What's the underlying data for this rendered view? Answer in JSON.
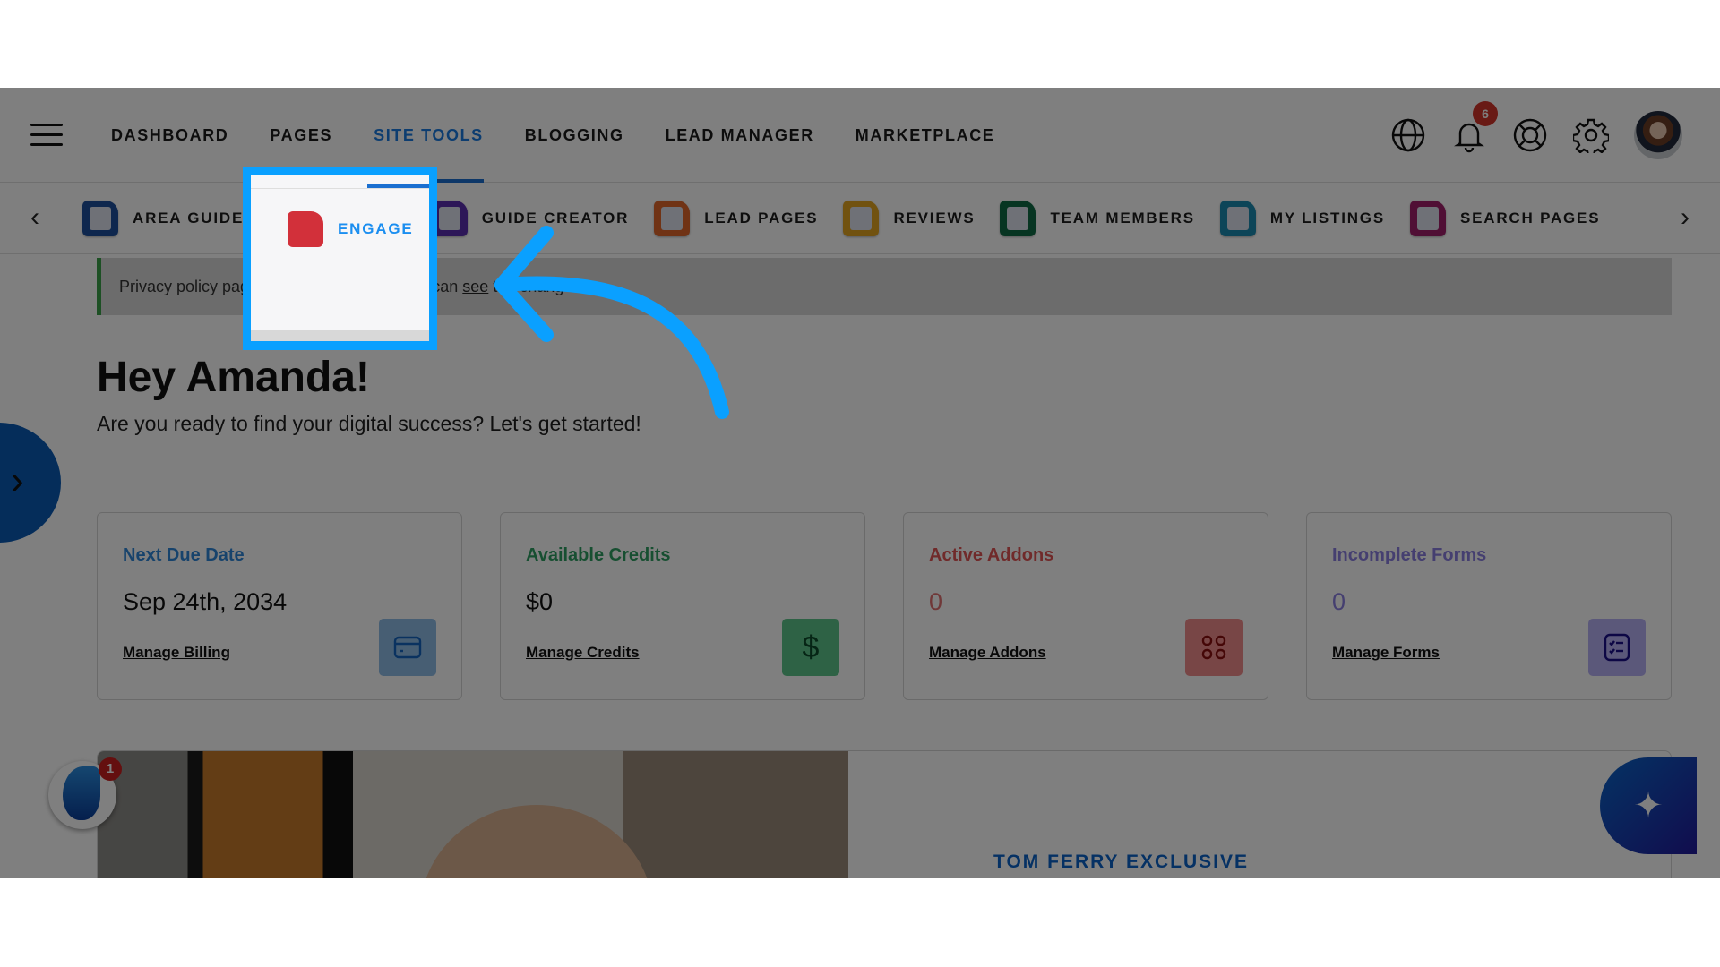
{
  "topnav": {
    "menu_icon": "hamburger-icon",
    "items": [
      {
        "label": "DASHBOARD",
        "active": false
      },
      {
        "label": "PAGES",
        "active": false
      },
      {
        "label": "SITE TOOLS",
        "active": true
      },
      {
        "label": "BLOGGING",
        "active": false
      },
      {
        "label": "LEAD MANAGER",
        "active": false
      },
      {
        "label": "MARKETPLACE",
        "active": false
      }
    ],
    "icons": [
      "globe-icon",
      "bell-icon",
      "help-lifebuoy-icon",
      "gear-icon"
    ],
    "notification_count": "6",
    "avatar": "user-avatar"
  },
  "subnav": {
    "prev_icon": "chevron-left-icon",
    "next_icon": "chevron-right-icon",
    "tabs": [
      {
        "label": "AREA GUIDES",
        "icon": "area-guide-icon",
        "icon_color": "#1c4f9c"
      },
      {
        "label": "ENGAGE",
        "icon": "engage-icon",
        "icon_color": "#d2303a",
        "highlighted": true
      },
      {
        "label": "GUIDE CREATOR",
        "icon": "guide-creator-icon",
        "icon_color": "#5a2fb0"
      },
      {
        "label": "LEAD PAGES",
        "icon": "lead-pages-icon",
        "icon_color": "#e0662a"
      },
      {
        "label": "REVIEWS",
        "icon": "reviews-icon",
        "icon_color": "#e3a420"
      },
      {
        "label": "TEAM MEMBERS",
        "icon": "team-members-icon",
        "icon_color": "#0f6a44"
      },
      {
        "label": "MY LISTINGS",
        "icon": "my-listings-icon",
        "icon_color": "#1a8ab0"
      },
      {
        "label": "SEARCH PAGES",
        "icon": "search-pages-icon",
        "icon_color": "#a01f6a"
      }
    ]
  },
  "notice": {
    "text_before": "Privacy policy page has been updated. You can ",
    "link": "see",
    "text_after": " the changes.",
    "accent": "#3aa048"
  },
  "greeting": {
    "title": "Hey Amanda!",
    "subtitle": "Are you ready to find your digital success? Let's get started!"
  },
  "cards": [
    {
      "title": "Next Due Date",
      "value": "Sep 24th, 2034",
      "link": "Manage Billing",
      "icon": "credit-card-icon",
      "color": "#2f86d8",
      "btn_bg": "#8fbce6"
    },
    {
      "title": "Available Credits",
      "value": "$0",
      "link": "Manage Credits",
      "icon": "dollar-icon",
      "color": "#2e9e62",
      "btn_bg": "#5cc48a"
    },
    {
      "title": "Active Addons",
      "value": "0",
      "link": "Manage Addons",
      "icon": "grid-icon",
      "color": "#e05454",
      "btn_bg": "#f08c8c"
    },
    {
      "title": "Incomplete Forms",
      "value": "0",
      "link": "Manage Forms",
      "icon": "checklist-icon",
      "color": "#8a7fe0",
      "btn_bg": "#b7b0f4"
    }
  ],
  "promo": {
    "title": "TOM FERRY EXCLUSIVE"
  },
  "widgets": {
    "flame_badge": "1",
    "ai_icon": "sparkle-icon"
  },
  "tutorial": {
    "highlight_color": "#0aa0ff",
    "target": "ENGAGE"
  }
}
